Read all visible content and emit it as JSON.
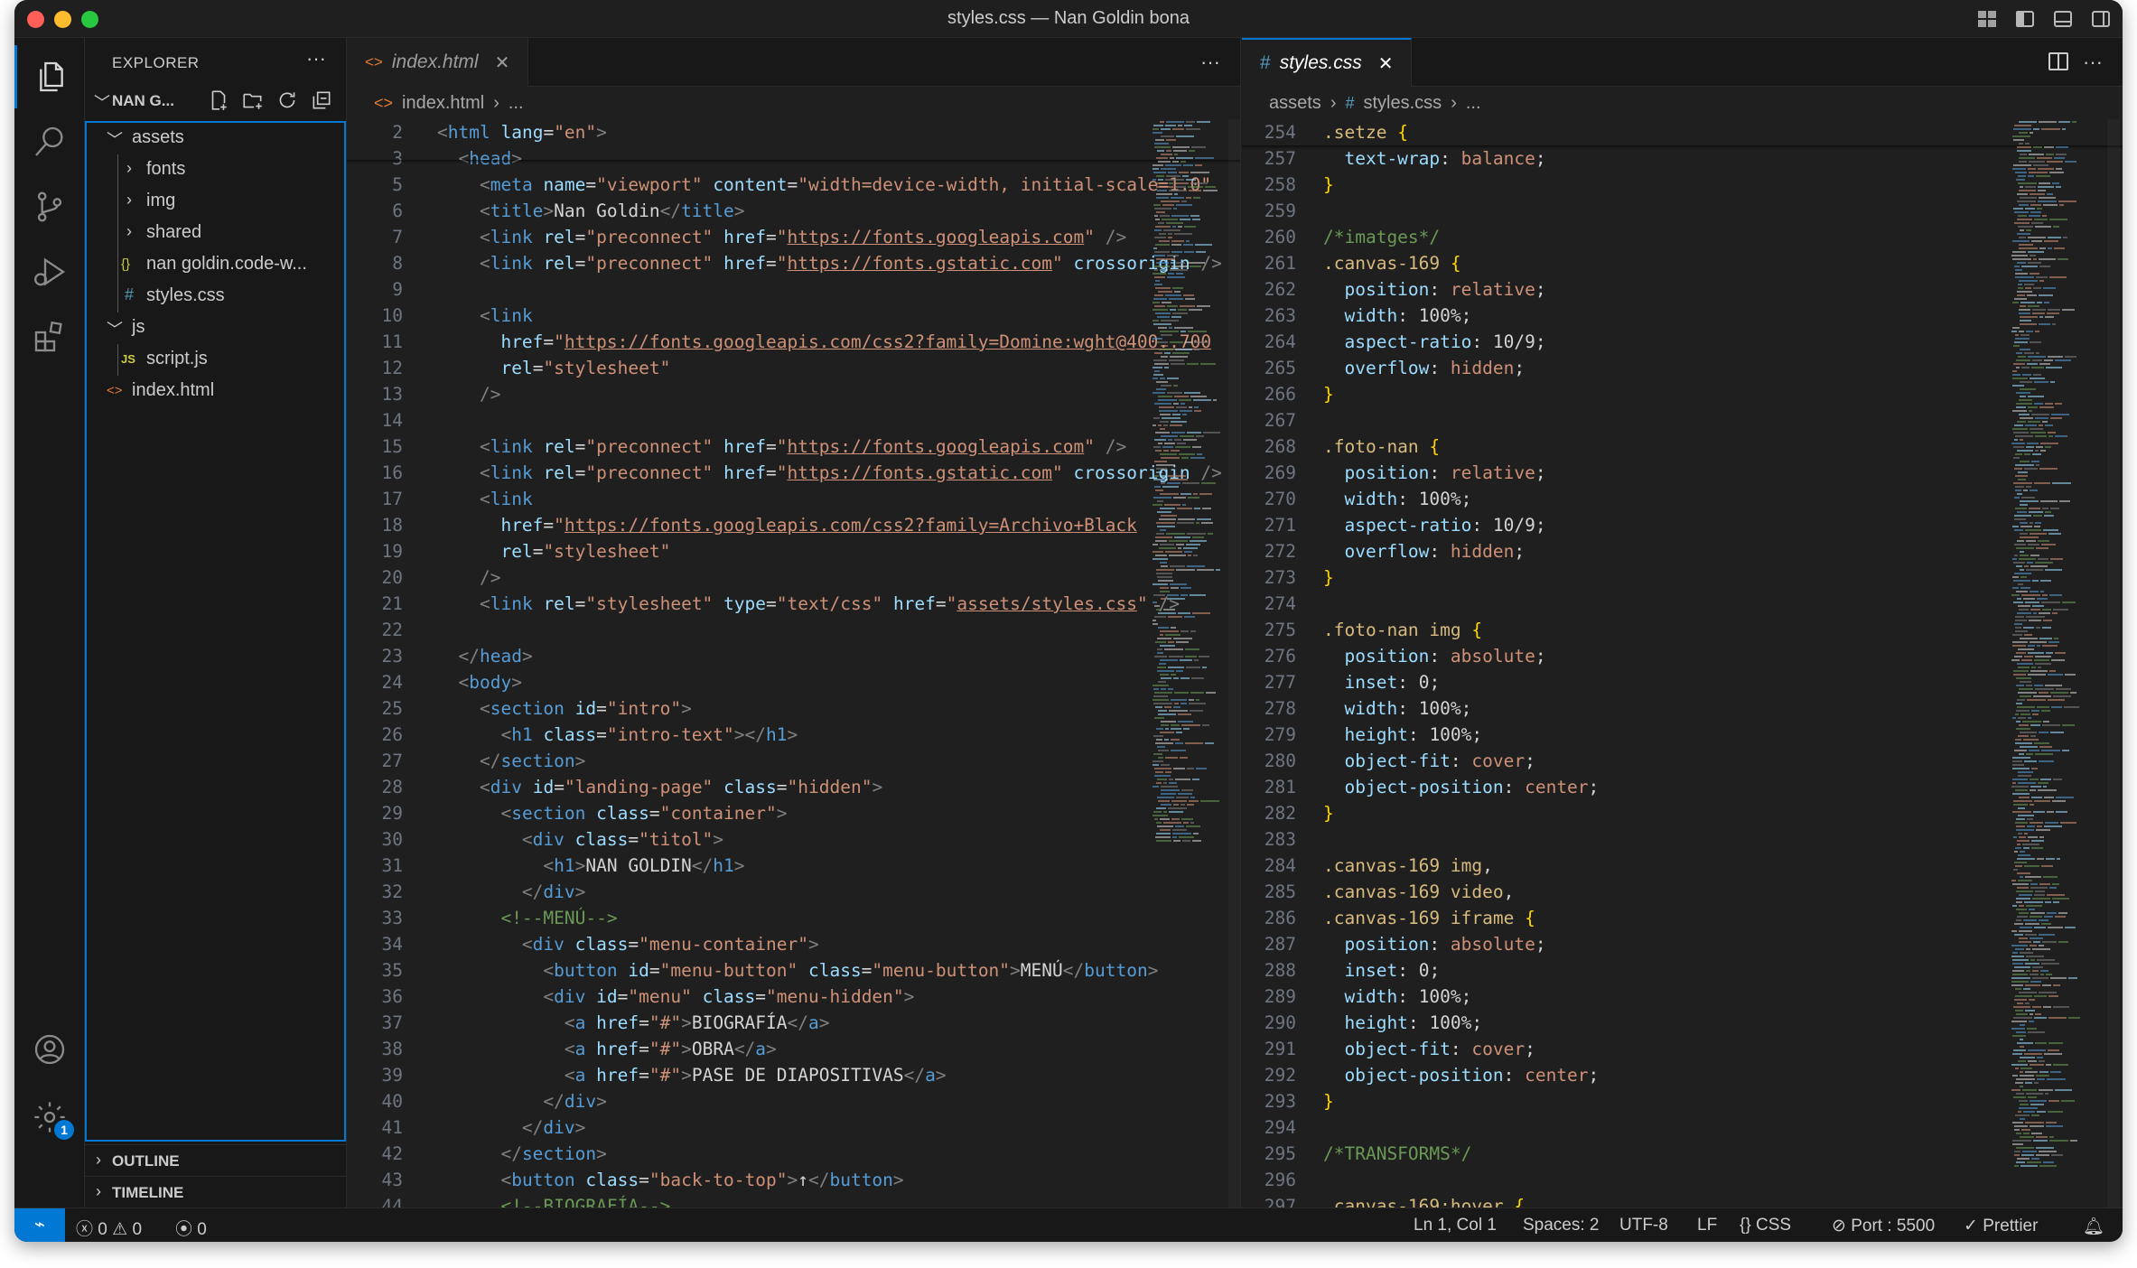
{
  "window": {
    "title": "styles.css — Nan Goldin bona"
  },
  "sidebar": {
    "title": "EXPLORER",
    "more": "···",
    "project": "NAN G...",
    "tree": [
      {
        "label": "assets",
        "icon": "chevron-down-icon",
        "glyph": "﹀",
        "depth": 1
      },
      {
        "label": "fonts",
        "icon": "chevron-right-icon",
        "glyph": "›",
        "depth": 2
      },
      {
        "label": "img",
        "icon": "chevron-right-icon",
        "glyph": "›",
        "depth": 2
      },
      {
        "label": "shared",
        "icon": "chevron-right-icon",
        "glyph": "›",
        "depth": 2
      },
      {
        "label": "nan goldin.code-w...",
        "icon": "json-file-icon",
        "glyph": "{}",
        "depth": 2
      },
      {
        "label": "styles.css",
        "icon": "css-file-icon",
        "glyph": "#",
        "depth": 2
      },
      {
        "label": "js",
        "icon": "chevron-down-icon",
        "glyph": "﹀",
        "depth": 1
      },
      {
        "label": "script.js",
        "icon": "js-file-icon",
        "glyph": "JS",
        "depth": 2
      },
      {
        "label": "index.html",
        "icon": "html-file-icon",
        "glyph": "<>",
        "depth": 1
      }
    ],
    "outline": "OUTLINE",
    "timeline": "TIMELINE",
    "settings_badge": "1"
  },
  "left_editor": {
    "tab": "index.html",
    "breadcrumb": [
      "index.html",
      "..."
    ],
    "lines": [
      {
        "n": "2",
        "html": "<span class='g'>&lt;</span><span class='k'>html</span> <span class='a'>lang</span><span class='w'>=</span><span class='s'>\"en\"</span><span class='g'>&gt;</span>"
      },
      {
        "n": "3",
        "html": "  <span class='g'>&lt;</span><span class='k'>head</span><span class='g'>&gt;</span>"
      },
      {
        "n": "5",
        "html": "    <span class='g'>&lt;</span><span class='k'>meta</span> <span class='a'>name</span><span class='w'>=</span><span class='s'>\"viewport\"</span> <span class='a'>content</span><span class='w'>=</span><span class='s'>\"width=device-width, initial-scale=1.0\"</span>"
      },
      {
        "n": "6",
        "html": "    <span class='g'>&lt;</span><span class='k'>title</span><span class='g'>&gt;</span><span class='w'>Nan Goldin</span><span class='g'>&lt;/</span><span class='k'>title</span><span class='g'>&gt;</span>"
      },
      {
        "n": "7",
        "html": "    <span class='g'>&lt;</span><span class='k'>link</span> <span class='a'>rel</span><span class='w'>=</span><span class='s'>\"preconnect\"</span> <span class='a'>href</span><span class='w'>=</span><span class='s'>\"</span><span class='u'>https://fonts.googleapis.com</span><span class='s'>\"</span> <span class='g'>/&gt;</span>"
      },
      {
        "n": "8",
        "html": "    <span class='g'>&lt;</span><span class='k'>link</span> <span class='a'>rel</span><span class='w'>=</span><span class='s'>\"preconnect\"</span> <span class='a'>href</span><span class='w'>=</span><span class='s'>\"</span><span class='u'>https://fonts.gstatic.com</span><span class='s'>\"</span> <span class='a'>crossorigin</span> <span class='g'>/&gt;</span>"
      },
      {
        "n": "9",
        "html": ""
      },
      {
        "n": "10",
        "html": "    <span class='g'>&lt;</span><span class='k'>link</span>"
      },
      {
        "n": "11",
        "html": "      <span class='a'>href</span><span class='w'>=</span><span class='s'>\"</span><span class='u'>https://fonts.googleapis.com/css2?family=Domine:wght@400..700</span>"
      },
      {
        "n": "12",
        "html": "      <span class='a'>rel</span><span class='w'>=</span><span class='s'>\"stylesheet\"</span>"
      },
      {
        "n": "13",
        "html": "    <span class='g'>/&gt;</span>"
      },
      {
        "n": "14",
        "html": ""
      },
      {
        "n": "15",
        "html": "    <span class='g'>&lt;</span><span class='k'>link</span> <span class='a'>rel</span><span class='w'>=</span><span class='s'>\"preconnect\"</span> <span class='a'>href</span><span class='w'>=</span><span class='s'>\"</span><span class='u'>https://fonts.googleapis.com</span><span class='s'>\"</span> <span class='g'>/&gt;</span>"
      },
      {
        "n": "16",
        "html": "    <span class='g'>&lt;</span><span class='k'>link</span> <span class='a'>rel</span><span class='w'>=</span><span class='s'>\"preconnect\"</span> <span class='a'>href</span><span class='w'>=</span><span class='s'>\"</span><span class='u'>https://fonts.gstatic.com</span><span class='s'>\"</span> <span class='a'>crossorigin</span> <span class='g'>/&gt;</span>"
      },
      {
        "n": "17",
        "html": "    <span class='g'>&lt;</span><span class='k'>link</span>"
      },
      {
        "n": "18",
        "html": "      <span class='a'>href</span><span class='w'>=</span><span class='s'>\"</span><span class='u'>https://fonts.googleapis.com/css2?family=Archivo+Black</span>"
      },
      {
        "n": "19",
        "html": "      <span class='a'>rel</span><span class='w'>=</span><span class='s'>\"stylesheet\"</span>"
      },
      {
        "n": "20",
        "html": "    <span class='g'>/&gt;</span>"
      },
      {
        "n": "21",
        "html": "    <span class='g'>&lt;</span><span class='k'>link</span> <span class='a'>rel</span><span class='w'>=</span><span class='s'>\"stylesheet\"</span> <span class='a'>type</span><span class='w'>=</span><span class='s'>\"text/css\"</span> <span class='a'>href</span><span class='w'>=</span><span class='s'>\"</span><span class='u'>assets/styles.css</span><span class='s'>\"</span> <span class='g'>/&gt;</span>"
      },
      {
        "n": "22",
        "html": ""
      },
      {
        "n": "23",
        "html": "  <span class='g'>&lt;/</span><span class='k'>head</span><span class='g'>&gt;</span>"
      },
      {
        "n": "24",
        "html": "  <span class='g'>&lt;</span><span class='k'>body</span><span class='g'>&gt;</span>"
      },
      {
        "n": "25",
        "html": "    <span class='g'>&lt;</span><span class='k'>section</span> <span class='a'>id</span><span class='w'>=</span><span class='s'>\"intro\"</span><span class='g'>&gt;</span>"
      },
      {
        "n": "26",
        "html": "      <span class='g'>&lt;</span><span class='k'>h1</span> <span class='a'>class</span><span class='w'>=</span><span class='s'>\"intro-text\"</span><span class='g'>&gt;&lt;/</span><span class='k'>h1</span><span class='g'>&gt;</span>"
      },
      {
        "n": "27",
        "html": "    <span class='g'>&lt;/</span><span class='k'>section</span><span class='g'>&gt;</span>"
      },
      {
        "n": "28",
        "html": "    <span class='g'>&lt;</span><span class='k'>div</span> <span class='a'>id</span><span class='w'>=</span><span class='s'>\"landing-page\"</span> <span class='a'>class</span><span class='w'>=</span><span class='s'>\"hidden\"</span><span class='g'>&gt;</span>"
      },
      {
        "n": "29",
        "html": "      <span class='g'>&lt;</span><span class='k'>section</span> <span class='a'>class</span><span class='w'>=</span><span class='s'>\"container\"</span><span class='g'>&gt;</span>"
      },
      {
        "n": "30",
        "html": "        <span class='g'>&lt;</span><span class='k'>div</span> <span class='a'>class</span><span class='w'>=</span><span class='s'>\"titol\"</span><span class='g'>&gt;</span>"
      },
      {
        "n": "31",
        "html": "          <span class='g'>&lt;</span><span class='k'>h1</span><span class='g'>&gt;</span><span class='w'>NAN GOLDIN</span><span class='g'>&lt;/</span><span class='k'>h1</span><span class='g'>&gt;</span>"
      },
      {
        "n": "32",
        "html": "        <span class='g'>&lt;/</span><span class='k'>div</span><span class='g'>&gt;</span>"
      },
      {
        "n": "33",
        "html": "      <span class='c'>&lt;!--MENÚ--&gt;</span>"
      },
      {
        "n": "34",
        "html": "        <span class='g'>&lt;</span><span class='k'>div</span> <span class='a'>class</span><span class='w'>=</span><span class='s'>\"menu-container\"</span><span class='g'>&gt;</span>"
      },
      {
        "n": "35",
        "html": "          <span class='g'>&lt;</span><span class='k'>button</span> <span class='a'>id</span><span class='w'>=</span><span class='s'>\"menu-button\"</span> <span class='a'>class</span><span class='w'>=</span><span class='s'>\"menu-button\"</span><span class='g'>&gt;</span><span class='w'>MENÚ</span><span class='g'>&lt;/</span><span class='k'>button</span><span class='g'>&gt;</span>"
      },
      {
        "n": "36",
        "html": "          <span class='g'>&lt;</span><span class='k'>div</span> <span class='a'>id</span><span class='w'>=</span><span class='s'>\"menu\"</span> <span class='a'>class</span><span class='w'>=</span><span class='s'>\"menu-hidden\"</span><span class='g'>&gt;</span>"
      },
      {
        "n": "37",
        "html": "            <span class='g'>&lt;</span><span class='k'>a</span> <span class='a'>href</span><span class='w'>=</span><span class='s'>\"#\"</span><span class='g'>&gt;</span><span class='w'>BIOGRAFÍA</span><span class='g'>&lt;/</span><span class='k'>a</span><span class='g'>&gt;</span>"
      },
      {
        "n": "38",
        "html": "            <span class='g'>&lt;</span><span class='k'>a</span> <span class='a'>href</span><span class='w'>=</span><span class='s'>\"#\"</span><span class='g'>&gt;</span><span class='w'>OBRA</span><span class='g'>&lt;/</span><span class='k'>a</span><span class='g'>&gt;</span>"
      },
      {
        "n": "39",
        "html": "            <span class='g'>&lt;</span><span class='k'>a</span> <span class='a'>href</span><span class='w'>=</span><span class='s'>\"#\"</span><span class='g'>&gt;</span><span class='w'>PASE DE DIAPOSITIVAS</span><span class='g'>&lt;/</span><span class='k'>a</span><span class='g'>&gt;</span>"
      },
      {
        "n": "40",
        "html": "          <span class='g'>&lt;/</span><span class='k'>div</span><span class='g'>&gt;</span>"
      },
      {
        "n": "41",
        "html": "        <span class='g'>&lt;/</span><span class='k'>div</span><span class='g'>&gt;</span>"
      },
      {
        "n": "42",
        "html": "      <span class='g'>&lt;/</span><span class='k'>section</span><span class='g'>&gt;</span>"
      },
      {
        "n": "43",
        "html": "      <span class='g'>&lt;</span><span class='k'>button</span> <span class='a'>class</span><span class='w'>=</span><span class='s'>\"back-to-top\"</span><span class='g'>&gt;</span><span class='w'>↑</span><span class='g'>&lt;/</span><span class='k'>button</span><span class='g'>&gt;</span>"
      },
      {
        "n": "44",
        "html": "      <span class='c'>&lt;!--BIOGRAFÍA--&gt;</span>"
      }
    ]
  },
  "right_editor": {
    "tab": "styles.css",
    "breadcrumb": [
      "assets",
      "styles.css",
      "..."
    ],
    "lines": [
      {
        "n": "254",
        "html": "<span class='sel'>.setze</span> <span class='b'>{</span>"
      },
      {
        "n": "257",
        "html": "  <span class='a'>text-wrap</span><span class='w'>:</span> <span class='s'>balance</span><span class='w'>;</span>"
      },
      {
        "n": "258",
        "html": "<span class='b'>}</span>"
      },
      {
        "n": "259",
        "html": ""
      },
      {
        "n": "260",
        "html": "<span class='c'>/*imatges*/</span>"
      },
      {
        "n": "261",
        "html": "<span class='sel'>.canvas-169</span> <span class='b'>{</span>"
      },
      {
        "n": "262",
        "html": "  <span class='a'>position</span><span class='w'>:</span> <span class='s'>relative</span><span class='w'>;</span>"
      },
      {
        "n": "263",
        "html": "  <span class='a'>width</span><span class='w'>:</span> <span class='w'>100%</span><span class='w'>;</span>"
      },
      {
        "n": "264",
        "html": "  <span class='a'>aspect-ratio</span><span class='w'>:</span> <span class='w'>10/9</span><span class='w'>;</span>"
      },
      {
        "n": "265",
        "html": "  <span class='a'>overflow</span><span class='w'>:</span> <span class='s'>hidden</span><span class='w'>;</span>"
      },
      {
        "n": "266",
        "html": "<span class='b'>}</span>"
      },
      {
        "n": "267",
        "html": ""
      },
      {
        "n": "268",
        "html": "<span class='sel'>.foto-nan</span> <span class='b'>{</span>"
      },
      {
        "n": "269",
        "html": "  <span class='a'>position</span><span class='w'>:</span> <span class='s'>relative</span><span class='w'>;</span>"
      },
      {
        "n": "270",
        "html": "  <span class='a'>width</span><span class='w'>:</span> <span class='w'>100%</span><span class='w'>;</span>"
      },
      {
        "n": "271",
        "html": "  <span class='a'>aspect-ratio</span><span class='w'>:</span> <span class='w'>10/9</span><span class='w'>;</span>"
      },
      {
        "n": "272",
        "html": "  <span class='a'>overflow</span><span class='w'>:</span> <span class='s'>hidden</span><span class='w'>;</span>"
      },
      {
        "n": "273",
        "html": "<span class='b'>}</span>"
      },
      {
        "n": "274",
        "html": ""
      },
      {
        "n": "275",
        "html": "<span class='sel'>.foto-nan img</span> <span class='b'>{</span>"
      },
      {
        "n": "276",
        "html": "  <span class='a'>position</span><span class='w'>:</span> <span class='s'>absolute</span><span class='w'>;</span>"
      },
      {
        "n": "277",
        "html": "  <span class='a'>inset</span><span class='w'>:</span> <span class='w'>0</span><span class='w'>;</span>"
      },
      {
        "n": "278",
        "html": "  <span class='a'>width</span><span class='w'>:</span> <span class='w'>100%</span><span class='w'>;</span>"
      },
      {
        "n": "279",
        "html": "  <span class='a'>height</span><span class='w'>:</span> <span class='w'>100%</span><span class='w'>;</span>"
      },
      {
        "n": "280",
        "html": "  <span class='a'>object-fit</span><span class='w'>:</span> <span class='s'>cover</span><span class='w'>;</span>"
      },
      {
        "n": "281",
        "html": "  <span class='a'>object-position</span><span class='w'>:</span> <span class='s'>center</span><span class='w'>;</span>"
      },
      {
        "n": "282",
        "html": "<span class='b'>}</span>"
      },
      {
        "n": "283",
        "html": ""
      },
      {
        "n": "284",
        "html": "<span class='sel'>.canvas-169 img</span><span class='w'>,</span>"
      },
      {
        "n": "285",
        "html": "<span class='sel'>.canvas-169 video</span><span class='w'>,</span>"
      },
      {
        "n": "286",
        "html": "<span class='sel'>.canvas-169 iframe</span> <span class='b'>{</span>"
      },
      {
        "n": "287",
        "html": "  <span class='a'>position</span><span class='w'>:</span> <span class='s'>absolute</span><span class='w'>;</span>"
      },
      {
        "n": "288",
        "html": "  <span class='a'>inset</span><span class='w'>:</span> <span class='w'>0</span><span class='w'>;</span>"
      },
      {
        "n": "289",
        "html": "  <span class='a'>width</span><span class='w'>:</span> <span class='w'>100%</span><span class='w'>;</span>"
      },
      {
        "n": "290",
        "html": "  <span class='a'>height</span><span class='w'>:</span> <span class='w'>100%</span><span class='w'>;</span>"
      },
      {
        "n": "291",
        "html": "  <span class='a'>object-fit</span><span class='w'>:</span> <span class='s'>cover</span><span class='w'>;</span>"
      },
      {
        "n": "292",
        "html": "  <span class='a'>object-position</span><span class='w'>:</span> <span class='s'>center</span><span class='w'>;</span>"
      },
      {
        "n": "293",
        "html": "<span class='b'>}</span>"
      },
      {
        "n": "294",
        "html": ""
      },
      {
        "n": "295",
        "html": "<span class='c'>/*TRANSFORMS*/</span>"
      },
      {
        "n": "296",
        "html": ""
      },
      {
        "n": "297",
        "html": "<span class='sel'>.canvas-169:hover</span> <span class='b'>{</span>"
      }
    ]
  },
  "statusbar": {
    "remote": "⌁",
    "errors": "0",
    "warnings": "0",
    "ports": "0",
    "cursor": "Ln 1, Col 1",
    "spaces": "Spaces: 2",
    "encoding": "UTF-8",
    "eol": "LF",
    "language": "CSS",
    "port": "Port : 5500",
    "prettier": "Prettier"
  },
  "colors": {
    "accent": "#0078d4",
    "editor_bg": "#1f1f1f",
    "panel_bg": "#181818"
  }
}
